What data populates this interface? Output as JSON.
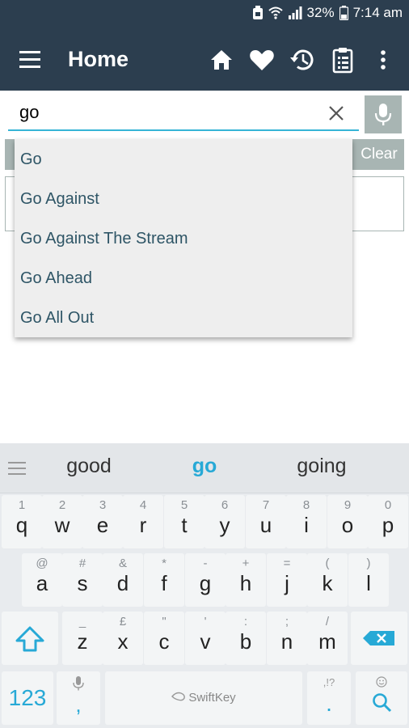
{
  "status_bar": {
    "battery_percent": "32%",
    "time": "7:14 am"
  },
  "app_bar": {
    "title": "Home",
    "icons": [
      "menu-icon",
      "home-icon",
      "heart-icon",
      "history-icon",
      "clipboard-icon",
      "more-vert-icon"
    ]
  },
  "search": {
    "value": "go",
    "clear_icon": "close-icon",
    "mic_icon": "mic-icon"
  },
  "clear_button": "Clear",
  "suggestions": [
    "Go",
    "Go Against",
    "Go Against The Stream",
    "Go Ahead",
    "Go All Out"
  ],
  "keyboard": {
    "predictions": [
      "good",
      "go",
      "going"
    ],
    "row1": [
      {
        "hint": "1",
        "key": "q"
      },
      {
        "hint": "2",
        "key": "w"
      },
      {
        "hint": "3",
        "key": "e"
      },
      {
        "hint": "4",
        "key": "r"
      },
      {
        "hint": "5",
        "key": "t"
      },
      {
        "hint": "6",
        "key": "y"
      },
      {
        "hint": "7",
        "key": "u"
      },
      {
        "hint": "8",
        "key": "i"
      },
      {
        "hint": "9",
        "key": "o"
      },
      {
        "hint": "0",
        "key": "p"
      }
    ],
    "row2": [
      {
        "hint": "@",
        "key": "a"
      },
      {
        "hint": "#",
        "key": "s"
      },
      {
        "hint": "&",
        "key": "d"
      },
      {
        "hint": "*",
        "key": "f"
      },
      {
        "hint": "-",
        "key": "g"
      },
      {
        "hint": "+",
        "key": "h"
      },
      {
        "hint": "=",
        "key": "j"
      },
      {
        "hint": "(",
        "key": "k"
      },
      {
        "hint": ")",
        "key": "l"
      }
    ],
    "row3": [
      {
        "hint": "_",
        "key": "z"
      },
      {
        "hint": "£",
        "key": "x"
      },
      {
        "hint": "\"",
        "key": "c"
      },
      {
        "hint": "'",
        "key": "v"
      },
      {
        "hint": ":",
        "key": "b"
      },
      {
        "hint": ";",
        "key": "n"
      },
      {
        "hint": "/",
        "key": "m"
      }
    ],
    "num_label": "123",
    "comma_key": ",",
    "space_brand": "SwiftKey",
    "period_hint": ",!?",
    "period_key": ".",
    "accent_color": "#27a9d6"
  }
}
